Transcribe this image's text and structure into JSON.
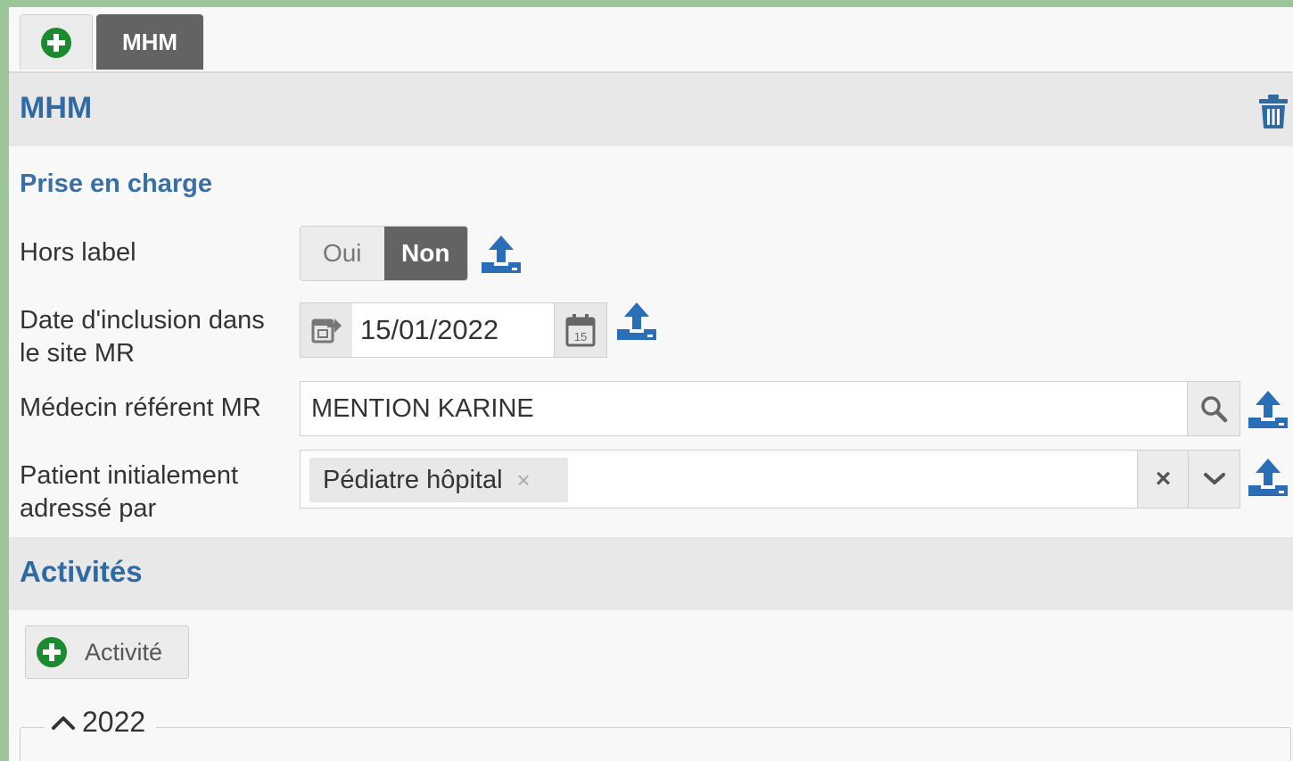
{
  "tabs": {
    "add_tab_icon": "plus-circle-icon",
    "active_tab_label": "MHM"
  },
  "section": {
    "title": "MHM",
    "delete_icon": "trash-icon"
  },
  "prise_en_charge": {
    "heading": "Prise en charge",
    "hors_label": {
      "label": "Hors label",
      "options": [
        "Oui",
        "Non"
      ],
      "selected": "Non"
    },
    "date_inclusion": {
      "label_line1": "Date d'inclusion dans",
      "label_line2": "le site MR",
      "value": "15/01/2022"
    },
    "medecin_referent": {
      "label": "Médecin référent MR",
      "value": "MENTION KARINE"
    },
    "patient_adresse": {
      "label_line1": "Patient initialement",
      "label_line2": "adressé par",
      "selected_chip": "Pédiatre hôpital",
      "chip_remove": "×",
      "clear": "×"
    }
  },
  "activites": {
    "title": "Activités",
    "add_button_label": "Activité",
    "year_group": "2022"
  },
  "colors": {
    "accent_blue": "#2f6aa3",
    "active_tab": "#636363",
    "add_green": "#1c8a2e",
    "background_green": "#9cc59a"
  }
}
